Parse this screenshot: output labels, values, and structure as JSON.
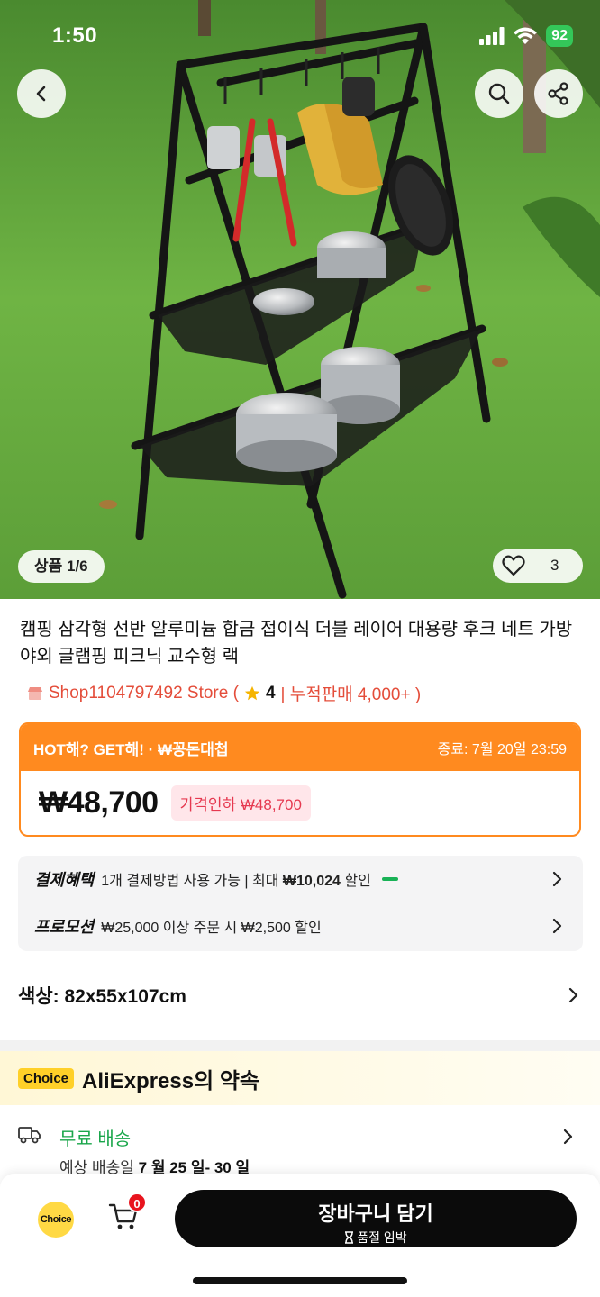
{
  "status": {
    "time": "1:50",
    "battery": "92"
  },
  "image": {
    "counter": "상품 1/6",
    "likes": "3"
  },
  "product": {
    "title": "캠핑 삼각형 선반 알루미늄 합금 접이식 더블 레이어 대용량 후크 네트 가방 야외 글램핑 피크닉 교수형 랙",
    "store": "Shop1104797492 Store (",
    "rating": "4",
    "sales": "| 누적판매 4,000+ )"
  },
  "promo": {
    "banner": "HOT해? GET해! · ₩꽁돈대첩",
    "ends": "종료: 7월 20일 23:59",
    "price": "₩48,700",
    "discount": "가격인하 ₩48,700"
  },
  "benefits": {
    "payment_key": "결제혜택",
    "payment_pre": "1개 결제방법 사용 가능 | 최대 ",
    "payment_amount": "₩10,024",
    "payment_post": " 할인",
    "promo_key": "프로모션",
    "promo_text": "₩25,000 이상 주문 시 ₩2,500 할인"
  },
  "variant": {
    "label": "색상: 82x55x107cm"
  },
  "choice": {
    "badge": "Choice",
    "title": "AliExpress의 약속"
  },
  "shipping": {
    "title": "무료 배송",
    "date_prefix": "예상 배송일 ",
    "date": "7 월 25 일- 30 일"
  },
  "bottom": {
    "choice_label": "Choice",
    "cart_count": "0",
    "cart_button": "장바구니 담기",
    "stock_note": "품절 임박"
  },
  "colors": {
    "accent_orange": "#ff8a1f",
    "price_red": "#e63950",
    "green": "#19a64a",
    "choice_yellow": "#ffd028"
  }
}
